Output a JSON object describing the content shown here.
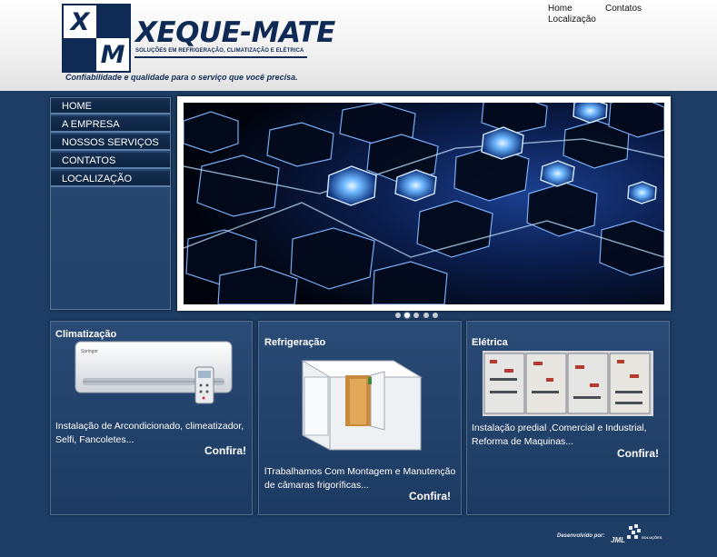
{
  "header": {
    "logo": {
      "letter_top": "X",
      "letter_bottom": "M"
    },
    "brand_name": "XEQUE-MATE",
    "brand_sub": "SOLUÇÕES EM REFRIGERAÇÃO, CLIMATIZAÇÃO E ELÉTRICA",
    "tagline": "Confiabilidade e qualidade para o serviço que você precisa.",
    "top_links": [
      "Home",
      "Contatos",
      "Localização"
    ]
  },
  "menu": [
    "HOME",
    "A EMPRESA",
    "NOSSOS SERVIÇOS",
    "CONTATOS",
    "LOCALIZAÇÃO"
  ],
  "slider": {
    "dot_count": 5,
    "active_dot": 1
  },
  "panels": [
    {
      "title": "Climatização",
      "text": "Instalação de Arcondicionado, climeatizador, Selfi, Fancoletes...",
      "link": "Confira!"
    },
    {
      "title": "Refrigeração",
      "text": "lTrabalhamos Com Montagem e Manutenção de câmaras frigoríficas...",
      "link": "Confira!"
    },
    {
      "title": "Elétrica",
      "text": "Instalação predial ,Comercial e Industrial, Reforma de Maquinas...",
      "link": "Confira!"
    }
  ],
  "footer": {
    "credit": "Desenvolvido por:",
    "dev_logo": "JML SOLUÇÕES"
  },
  "colors": {
    "navy": "#0f2b55",
    "background": "#1d3d64",
    "menu": "#0d2442"
  }
}
